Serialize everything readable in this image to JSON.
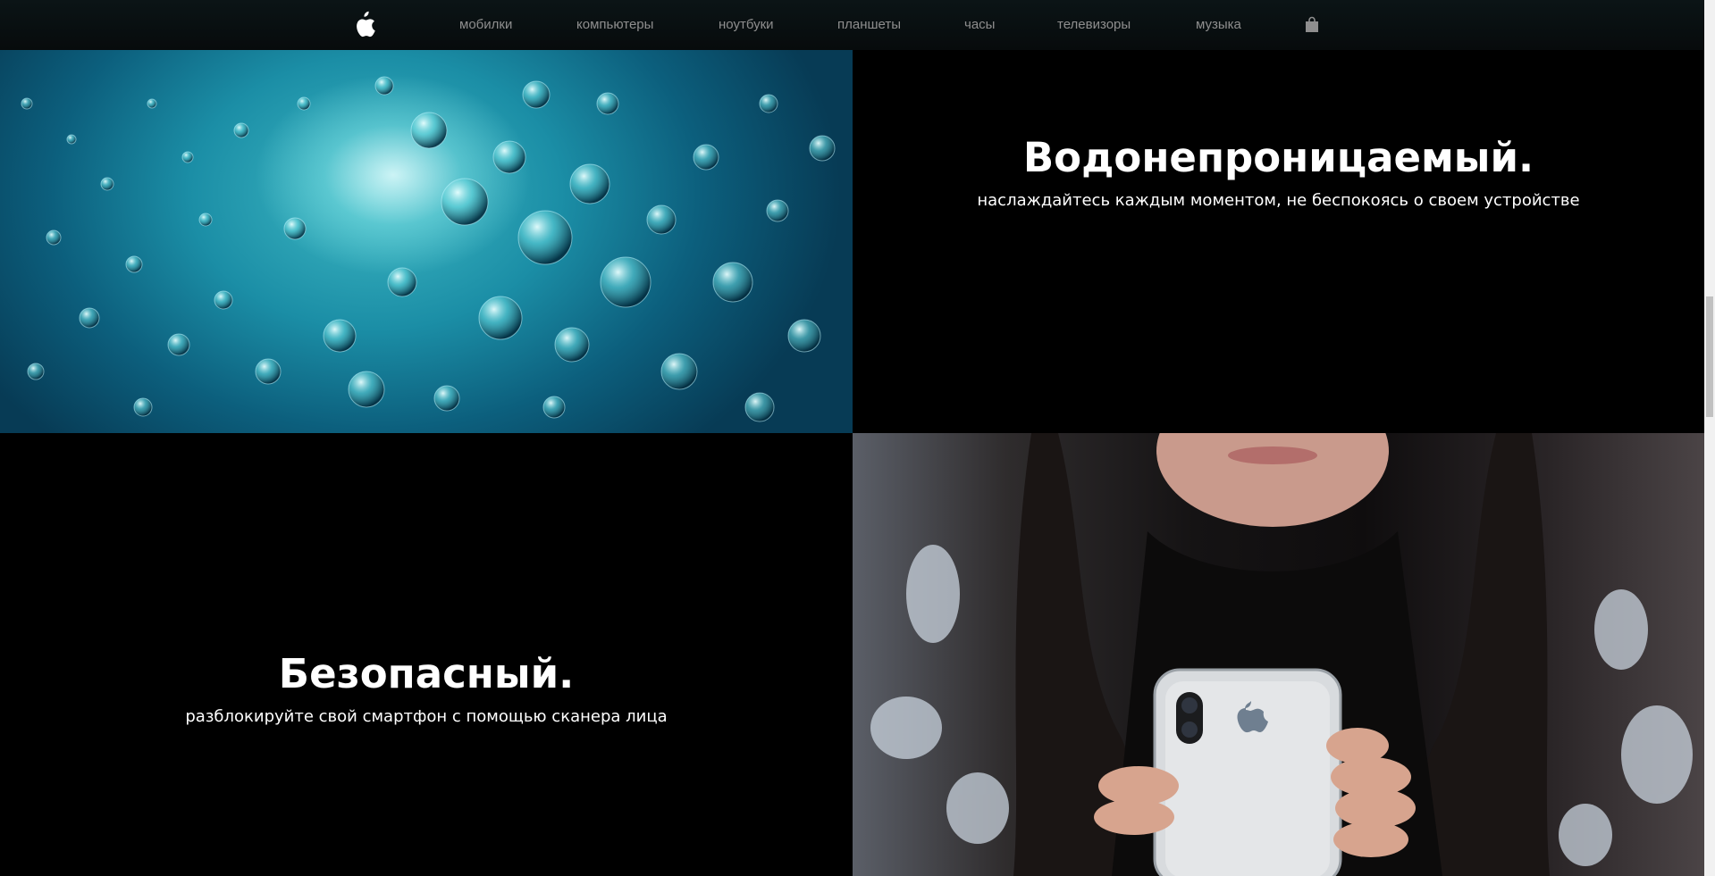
{
  "nav": {
    "logo_icon": "apple-logo-icon",
    "links": [
      "мобилки",
      "компьютеры",
      "ноутбуки",
      "планшеты",
      "часы",
      "телевизоры",
      "музыка"
    ],
    "bag_icon": "shopping-bag-icon"
  },
  "section_waterproof": {
    "title": "Водонепроницаемый.",
    "subtitle": "наслаждайтесь каждым моментом, не беспокоясь о своем устройстве",
    "image": "underwater-bubbles-photo"
  },
  "section_secure": {
    "title": "Безопасный.",
    "subtitle": "разблокируйте свой смартфон с помощью сканера лица",
    "image": "woman-holding-iphone-photo"
  },
  "colors": {
    "background": "#000000",
    "nav_text": "#8e8e8e",
    "headline": "#ffffff"
  }
}
